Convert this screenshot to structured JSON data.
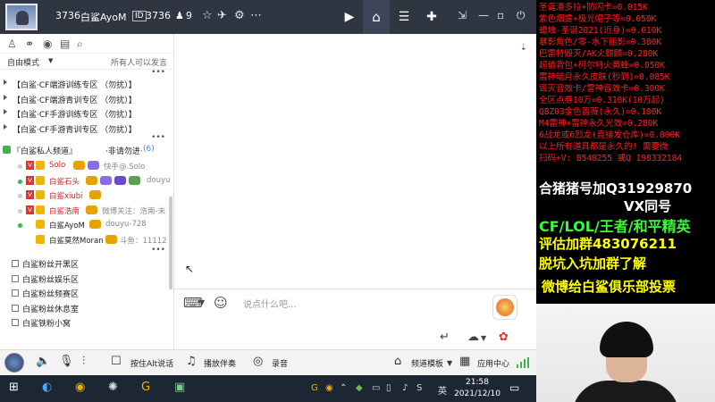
{
  "titlebar": {
    "room_id": "3736",
    "username": "白鲨AyoM",
    "room_badge": "3736",
    "viewer_count": "9"
  },
  "left_panel": {
    "mode_label": "自由模式",
    "mode_arrow": "▼",
    "permission_label": "所有人可以发言",
    "channels_top": [
      "【白鲨·CF端游训练专区 （勿扰）】",
      "【白鲨·CF端游青训专区 （勿扰）】",
      "【白鲨·CF手游训练专区 （勿扰）】",
      "【白鲨·CF手游青训专区 （勿扰）】"
    ],
    "private_channel": {
      "label": "『白鲨私人频道』",
      "note": "·非请勿进·",
      "count": "(6)"
    },
    "members": [
      {
        "name": "Solo",
        "extra": "快手@.Solo"
      },
      {
        "name": "白鲨石头",
        "extra": "douyu"
      },
      {
        "name": "白鲨xiubi",
        "extra": ""
      },
      {
        "name": "白鲨浩南",
        "extra": "微博关注：浩南-未"
      },
      {
        "name": "白鲨AyoM",
        "extra": "douyu-728"
      },
      {
        "name": "白鲨莫然Moran",
        "extra": "斗鱼：11112"
      }
    ],
    "groups_bottom": [
      "白鲨粉丝开黑区",
      "白鲨粉丝娱乐区",
      "白鲨粉丝频赛区",
      "白鲨粉丝休息室",
      "白鲨铁粉小窝"
    ]
  },
  "input_bar": {
    "placeholder": "说点什么吧..."
  },
  "toolbar": {
    "push_to_talk": "按住Alt说话",
    "play_music": "播放伴奏",
    "record": "录音",
    "channel_template": "频道模板",
    "app_center": "应用中心"
  },
  "taskbar": {
    "ime": "英",
    "time": "21:58",
    "date": "2021/12/10"
  },
  "overlay": {
    "price_lines": [
      "圣诞潘多拉+防闪卡=0.015K",
      "紫色烟雾+极光帽子等=0.050K",
      "蜡烛-圣诞2021(近身)=0.010K",
      "暴影角色/零-水下丽影=0.380K",
      "巴雷特毁灭/AK火麒麟=0.280K",
      "超值背包+柯尔特火黄蜂=0.050K",
      "雷神暗月永久皮肤(秒到)=0.085K",
      "毁灭音效卡/雷神音效卡=0.300K",
      "全区点券10万=0.310K(10万起)",
      "QBZ03金色蔷薇(永久)=0.180K",
      "M4雷神+雷神永久光效=0.280K",
      "6战龙或6烈龙(直接发仓库)=0.800K",
      "以上所有道具都是永久的! 需要微",
      "扫码+V: B548255  或Q 198332184"
    ],
    "contact_line1": "合猪猪号加Q31929870",
    "contact_line2": "VX同号",
    "games_line": "CF/LOL/王者/和平精英",
    "group_line": "评估加群483076211",
    "recruit_line": "脱坑入坑加群了解",
    "weibo_line": "微博给白鲨俱乐部投票"
  },
  "colors": {
    "titlebar_bg": "#2f3541",
    "overlay_red": "#ff2020",
    "overlay_white": "#ffffff",
    "overlay_yellow": "#ffff00",
    "overlay_green": "#33ff33"
  }
}
